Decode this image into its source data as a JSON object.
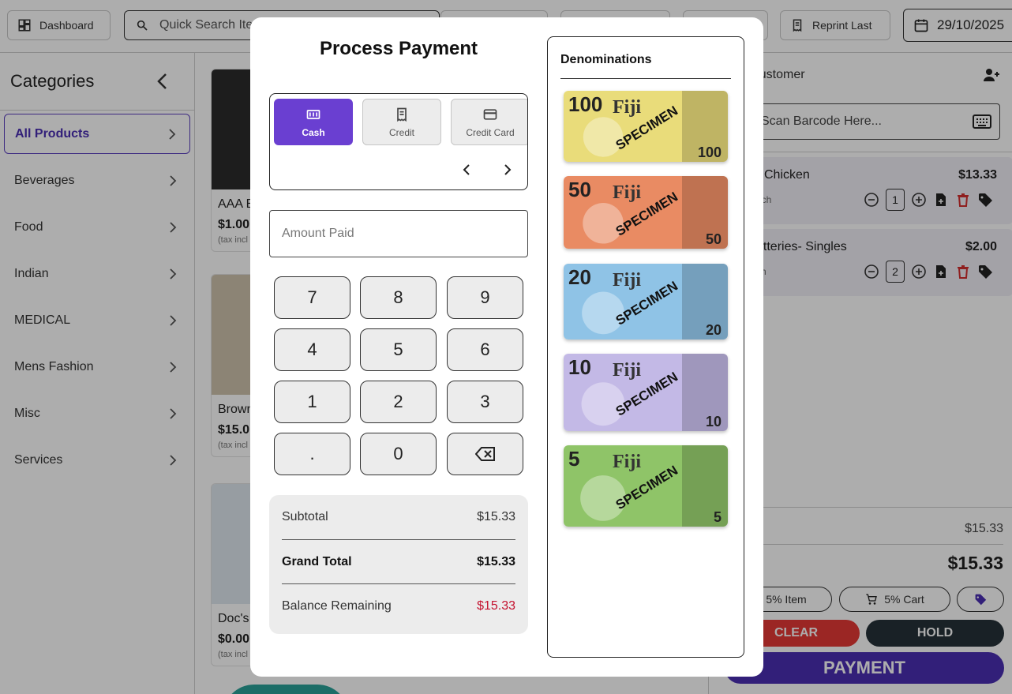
{
  "topbar": {
    "dashboard_label": "Dashboard",
    "search_placeholder": "Quick Search Ite",
    "reprint_label": "Reprint Last",
    "date": "29/10/2025"
  },
  "sidebar": {
    "title": "Categories",
    "items": [
      {
        "label": "All Products"
      },
      {
        "label": "Beverages"
      },
      {
        "label": "Food"
      },
      {
        "label": "Indian"
      },
      {
        "label": "MEDICAL"
      },
      {
        "label": "Mens Fashion"
      },
      {
        "label": "Misc"
      },
      {
        "label": "Services"
      }
    ]
  },
  "products": [
    {
      "name": "AAA B",
      "price": "$1.00",
      "tax": "(tax incl"
    },
    {
      "name": "Brown",
      "price": "$15.0",
      "tax": "(tax incl"
    },
    {
      "name": "Doc's",
      "price": "$0.00",
      "tax": "(tax incl"
    }
  ],
  "cart": {
    "customer": "k-in Customer",
    "scan_placeholder": "Scan Barcode Here...",
    "items": [
      {
        "name": "Chicken",
        "price": "$13.33",
        "unit": "ach",
        "qty": "1"
      },
      {
        "name": "atteries- Singles",
        "price": "$2.00",
        "unit": "ch",
        "qty": "2"
      }
    ],
    "subtotal_label": "al",
    "subtotal": "$15.33",
    "total": "$15.33",
    "item_discount": "5% Item",
    "cart_discount": "5% Cart",
    "clear_label": "CLEAR",
    "hold_label": "HOLD",
    "payment_label": "PAYMENT"
  },
  "modal": {
    "title": "Process Payment",
    "methods": [
      {
        "label": "Cash",
        "active": true
      },
      {
        "label": "Credit",
        "active": false
      },
      {
        "label": "Credit Card",
        "active": false
      }
    ],
    "amount_placeholder": "Amount Paid",
    "keys": [
      "7",
      "8",
      "9",
      "4",
      "5",
      "6",
      "1",
      "2",
      "3",
      ".",
      "0"
    ],
    "totals": {
      "subtotal_label": "Subtotal",
      "subtotal": "$15.33",
      "grand_label": "Grand Total",
      "grand": "$15.33",
      "balance_label": "Balance Remaining",
      "balance": "$15.33"
    },
    "denominations_title": "Denominations",
    "notes": [
      {
        "value": "100",
        "word": "SPECIMEN",
        "color": "#e9dc7a"
      },
      {
        "value": "50",
        "word": "SPECIMEN",
        "color": "#e98b63"
      },
      {
        "value": "20",
        "word": "SPECIMEN",
        "color": "#8fc3e6"
      },
      {
        "value": "10",
        "word": "SPECIMEN",
        "color": "#c3b9e6"
      },
      {
        "value": "5",
        "word": "SPECIMEN",
        "color": "#8fc468"
      }
    ]
  },
  "colors": {
    "accent": "#6a3fd1",
    "danger": "#c4122f",
    "clear_button": "#e53935",
    "hold_button": "#263238"
  }
}
